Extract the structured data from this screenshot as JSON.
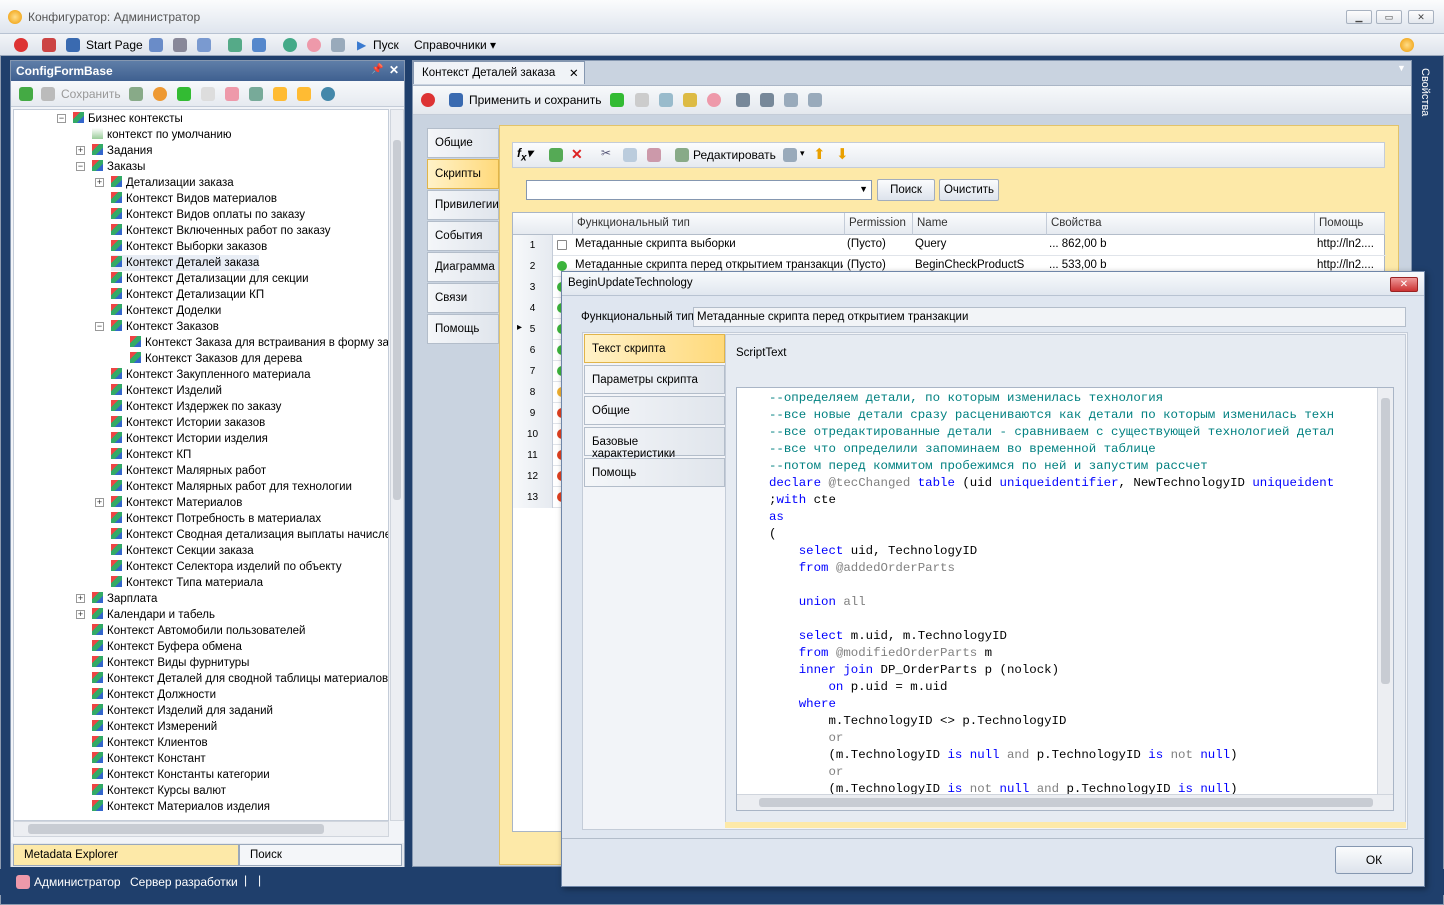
{
  "app": {
    "title": "Конфигуратор: Администратор"
  },
  "menu": {
    "start_page": "Start Page",
    "run": "Пуск",
    "references": "Справочники"
  },
  "left_panel": {
    "title": "ConfigFormBase",
    "save_label": "Сохранить",
    "tree": [
      {
        "label": "Бизнес контексты",
        "level": 1,
        "exp": "-"
      },
      {
        "label": "контекст по умолчанию",
        "level": 2,
        "exp": ""
      },
      {
        "label": "Задания",
        "level": 2,
        "exp": "+"
      },
      {
        "label": "Заказы",
        "level": 2,
        "exp": "-"
      },
      {
        "label": "Детализации заказа",
        "level": 3,
        "exp": "+"
      },
      {
        "label": "Контекст Видов материалов",
        "level": 3,
        "exp": ""
      },
      {
        "label": "Контекст Видов оплаты по заказу",
        "level": 3,
        "exp": ""
      },
      {
        "label": "Контекст Включенных работ по заказу",
        "level": 3,
        "exp": ""
      },
      {
        "label": "Контекст Выборки заказов",
        "level": 3,
        "exp": ""
      },
      {
        "label": "Контекст Деталей заказа",
        "level": 3,
        "exp": ""
      },
      {
        "label": "Контекст Детализации для секции",
        "level": 3,
        "exp": ""
      },
      {
        "label": "Контекст Детализации КП",
        "level": 3,
        "exp": ""
      },
      {
        "label": "Контекст Доделки",
        "level": 3,
        "exp": ""
      },
      {
        "label": "Контекст Заказов",
        "level": 3,
        "exp": "-"
      },
      {
        "label": "Контекст Заказа для встраивания в форму заказа",
        "level": 4,
        "exp": ""
      },
      {
        "label": "Контекст Заказов для дерева",
        "level": 4,
        "exp": ""
      },
      {
        "label": "Контекст Закупленного материала",
        "level": 3,
        "exp": ""
      },
      {
        "label": "Контекст Изделий",
        "level": 3,
        "exp": ""
      },
      {
        "label": "Контекст Издержек по заказу",
        "level": 3,
        "exp": ""
      },
      {
        "label": "Контекст Истории заказов",
        "level": 3,
        "exp": ""
      },
      {
        "label": "Контекст Истории изделия",
        "level": 3,
        "exp": ""
      },
      {
        "label": "Контекст КП",
        "level": 3,
        "exp": ""
      },
      {
        "label": "Контекст Малярных работ",
        "level": 3,
        "exp": ""
      },
      {
        "label": "Контекст Малярных работ для технологии",
        "level": 3,
        "exp": ""
      },
      {
        "label": "Контекст Материалов",
        "level": 3,
        "exp": "+"
      },
      {
        "label": "Контекст Потребность в материалах",
        "level": 3,
        "exp": ""
      },
      {
        "label": "Контекст Сводная детализация выплаты начисленно",
        "level": 3,
        "exp": ""
      },
      {
        "label": "Контекст Секции заказа",
        "level": 3,
        "exp": ""
      },
      {
        "label": "Контекст Селектора изделий по объекту",
        "level": 3,
        "exp": ""
      },
      {
        "label": "Контекст Типа материала",
        "level": 3,
        "exp": ""
      },
      {
        "label": "Зарплата",
        "level": 2,
        "exp": "+"
      },
      {
        "label": "Календари и табель",
        "level": 2,
        "exp": "+"
      },
      {
        "label": "Контекст Автомобили пользователей",
        "level": 2,
        "exp": ""
      },
      {
        "label": "Контекст Буфера обмена",
        "level": 2,
        "exp": ""
      },
      {
        "label": "Контекст Виды фурнитуры",
        "level": 2,
        "exp": ""
      },
      {
        "label": "Контекст Деталей для сводной таблицы материалов",
        "level": 2,
        "exp": ""
      },
      {
        "label": "Контекст Должности",
        "level": 2,
        "exp": ""
      },
      {
        "label": "Контекст Изделий для заданий",
        "level": 2,
        "exp": ""
      },
      {
        "label": "Контекст Измерений",
        "level": 2,
        "exp": ""
      },
      {
        "label": "Контекст Клиентов",
        "level": 2,
        "exp": ""
      },
      {
        "label": "Контекст Констант",
        "level": 2,
        "exp": ""
      },
      {
        "label": "Контекст Константы категории",
        "level": 2,
        "exp": ""
      },
      {
        "label": "Контекст Курсы валют",
        "level": 2,
        "exp": ""
      },
      {
        "label": "Контекст Материалов изделия",
        "level": 2,
        "exp": ""
      }
    ],
    "tabs": [
      "Metadata Explorer",
      "Поиск"
    ]
  },
  "document": {
    "tab_title": "Контекст Деталей заказа",
    "apply_save": "Применить и сохранить",
    "side_tabs": [
      "Общие",
      "Скрипты",
      "Привилегии",
      "События",
      "Диаграмма",
      "Связи",
      "Помощь"
    ],
    "edit_label": "Редактировать",
    "search_btn": "Поиск",
    "clear_btn": "Очистить",
    "columns": [
      "Функциональный тип",
      "Permission",
      "Name",
      "Свойства",
      "Помощь"
    ],
    "rows": [
      {
        "n": "1",
        "type": "Метаданные скрипта выборки",
        "perm": "(Пусто)",
        "name": "Query",
        "props": "... 862,00 b",
        "help": "http://ln2....",
        "color": "#ffffff"
      },
      {
        "n": "2",
        "type": "Метаданные скрипта перед открытием транзакции",
        "perm": "(Пусто)",
        "name": "BeginCheckProductS",
        "props": "... 533,00 b",
        "help": "http://ln2....",
        "color": "#3cb43c"
      },
      {
        "n": "3",
        "color": "#3cb43c"
      },
      {
        "n": "4",
        "color": "#3cb43c"
      },
      {
        "n": "5",
        "color": "#3cb43c"
      },
      {
        "n": "6",
        "color": "#3cb43c"
      },
      {
        "n": "7",
        "color": "#3cb43c"
      },
      {
        "n": "8",
        "color": "#f0b030"
      },
      {
        "n": "9",
        "color": "#e04020"
      },
      {
        "n": "10",
        "color": "#e04020"
      },
      {
        "n": "11",
        "color": "#e04020"
      },
      {
        "n": "12",
        "color": "#e04020"
      },
      {
        "n": "13",
        "color": "#e04020"
      }
    ]
  },
  "right_strip": "Свойства",
  "dialog": {
    "title": "BeginUpdateTechnology",
    "func_type_label": "Функциональный тип",
    "func_type_value": "Метаданные скрипта перед открытием транзакции",
    "tabs": [
      "Текст скрипта",
      "Параметры скрипта",
      "Общие",
      "Базовые характеристики",
      "Помощь"
    ],
    "section_title": "ScriptText",
    "ok": "ОК"
  },
  "status": {
    "user": "Администратор",
    "server": "Сервер разработки"
  }
}
